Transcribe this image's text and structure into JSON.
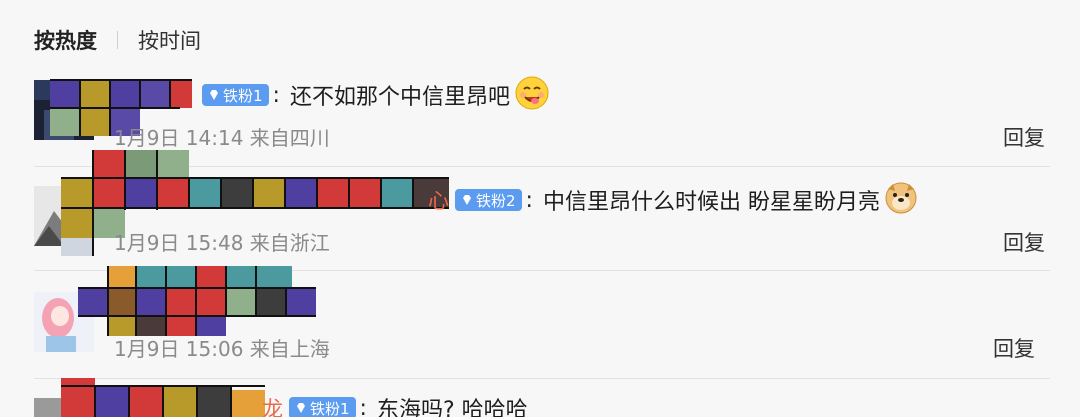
{
  "sort": {
    "hot": "按热度",
    "time": "按时间"
  },
  "comments": [
    {
      "badge": "铁粉1",
      "colon": ":",
      "text": "还不如那个中信里昂吧",
      "meta": "1月9日 14:14 来自四川",
      "reply": "回复",
      "username": ""
    },
    {
      "badge": "铁粉2",
      "colon": ":",
      "text": "中信里昂什么时候出 盼星星盼月亮",
      "meta": "1月9日 15:48 来自浙江",
      "reply": "回复",
      "username": "心"
    },
    {
      "meta": "1月9日 15:06 来自上海",
      "reply": "回复"
    },
    {
      "badge": "铁粉1",
      "colon": ":",
      "text": "东海吗? 哈哈哈",
      "username": "龙"
    }
  ],
  "colors": {
    "badge_bg": "#5b9bf0",
    "username": "#e86a4a",
    "meta": "#8a8a8a"
  }
}
